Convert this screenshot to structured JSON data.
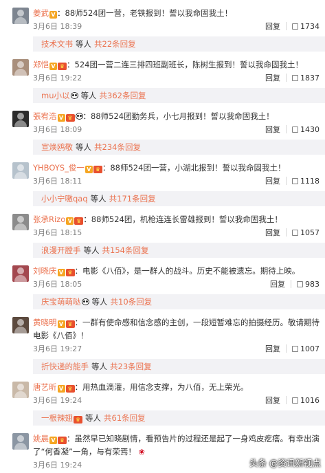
{
  "comments": [
    {
      "user": "姜武",
      "sep": "：",
      "text": "88师524团一营，老铁报到！誓以我命固我土！",
      "time": "3月6日 18:39",
      "reply": "回复",
      "likes": "1734"
    },
    {
      "user": "郑恺",
      "sep": "：",
      "text": "524团一营二连三排四班副班长，陈树生报到！誓以我命固我土！",
      "time": "3月6日 19:22",
      "reply": "回复",
      "likes": "1837"
    },
    {
      "user": "張宥浩",
      "sep": "：",
      "text": "88师524团勤务兵，小七月报到！誓以我命固我土！",
      "time": "3月6日 18:09",
      "reply": "回复",
      "likes": "1430"
    },
    {
      "user": "YHBOYS_俊一",
      "sep": "：",
      "text": "88师524团一营，小湖北报到！誓以我命固我土！",
      "time": "3月6日 18:11",
      "reply": "回复",
      "likes": "1118"
    },
    {
      "user": "张承Rizo",
      "sep": "：",
      "text": "88师524团，机枪连连长雷雄报到！誓以我命固我土！",
      "time": "3月6日 18:15",
      "reply": "回复",
      "likes": "1057"
    },
    {
      "user": "刘晓庆",
      "sep": "：",
      "text": "电影《八佰》，是一群人的战斗。历史不能被遗忘。期待上映。",
      "time": "3月6日 18:05",
      "reply": "回复",
      "likes": "983"
    },
    {
      "user": "黄晓明",
      "sep": "：",
      "text": "一群有使命感和信念感的主创，一段短暂难忘的拍摄经历。敬请期待电影《八佰》！",
      "time": "3月6日 19:27",
      "reply": "回复",
      "likes": "1007"
    },
    {
      "user": "唐艺昕",
      "sep": "：",
      "text": "用热血滴灌，用信念支撑，为八佰，无上荣光。",
      "time": "3月6日 19:24",
      "reply": "回复",
      "likes": "1016"
    },
    {
      "user": "姚晨",
      "sep": "：",
      "text": "虽然早已知晓剧情，看预告片的过程还是起了一身鸡皮疙瘩。有幸出演了“何香凝”一角，与有荣焉！",
      "time": "3月6日 19:24",
      "reply": "",
      "likes": ""
    }
  ],
  "subreplies": [
    {
      "name": "技术文书",
      "etc": "等人",
      "more": "共22条回复"
    },
    {
      "name": "mu小以",
      "etc": "等人",
      "more": "共362条回复"
    },
    {
      "name": "宣焕鸥敬",
      "etc": "等人",
      "more": "共234条回复"
    },
    {
      "name": "小小宁嗷qaq",
      "etc": "等人",
      "more": "共171条回复"
    },
    {
      "name": "浪漫开膛手",
      "etc": "等人",
      "more": "共154条回复"
    },
    {
      "name": "庆宝萌萌哒",
      "etc": "等人",
      "more": "共10条回复"
    },
    {
      "name": "折快递的能手",
      "etc": "等人",
      "more": "共23条回复"
    },
    {
      "name": "一根辣翅",
      "etc": "等人",
      "more": "共61条回复"
    }
  ],
  "watermark": "头条 @资讯新视点",
  "colors": {
    "username": "#eb7350",
    "meta": "#808080",
    "subreply_bg": "#f2f2f5"
  },
  "icons": {
    "like": "thumb-up-icon",
    "verified": "v-badge-icon",
    "vip": "vip-badge-icon",
    "panda": "panda-emoji-icon",
    "rose": "rose-emoji-icon"
  }
}
